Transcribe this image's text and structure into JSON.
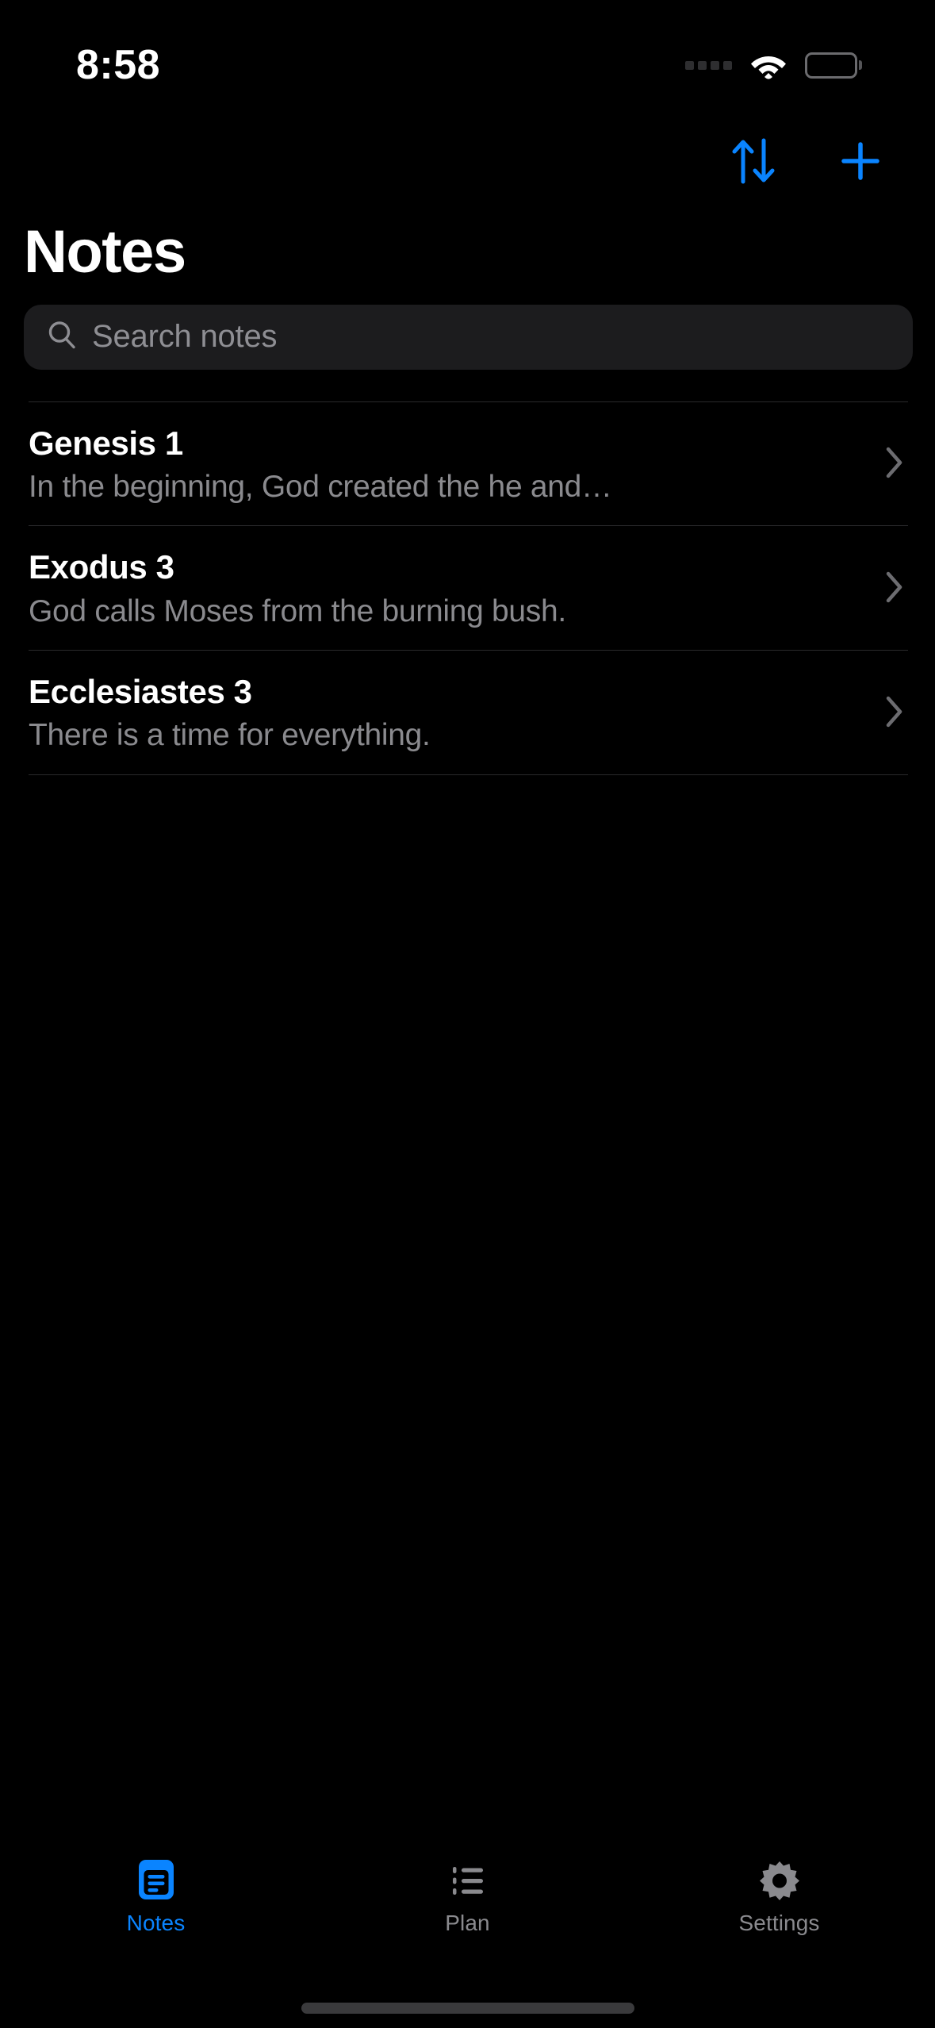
{
  "theme": {
    "background": "#000000",
    "accent": "#0a84ff",
    "secondary_text": "#8a8a8e",
    "search_field_bg": "#1c1c1e",
    "divider": "#2a2a2c"
  },
  "status_bar": {
    "time": "8:58",
    "signal_icon": "cellular-signal-icon",
    "wifi_icon": "wifi-icon",
    "battery_icon": "battery-icon"
  },
  "toolbar": {
    "sort_label": "sort-arrows-icon",
    "add_label": "plus-icon"
  },
  "header": {
    "title": "Notes"
  },
  "search": {
    "placeholder": "Search notes",
    "value": "",
    "icon": "search-icon"
  },
  "notes": [
    {
      "title": "Genesis 1",
      "preview": "In the beginning, God created the he and…"
    },
    {
      "title": "Exodus 3",
      "preview": "God calls Moses from the burning bush."
    },
    {
      "title": "Ecclesiastes 3",
      "preview": "There is a time for everything."
    }
  ],
  "tab_bar": {
    "items": [
      {
        "label": "Notes",
        "icon": "note-document-icon",
        "active": true
      },
      {
        "label": "Plan",
        "icon": "bulleted-list-icon",
        "active": false
      },
      {
        "label": "Settings",
        "icon": "gear-icon",
        "active": false
      }
    ]
  }
}
